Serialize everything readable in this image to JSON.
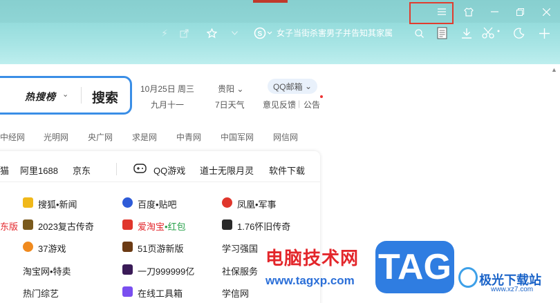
{
  "browser": {
    "news_headline": "女子当街杀害男子并告知其家属",
    "window_controls": [
      "menu-icon",
      "skin-icon",
      "minimize-icon",
      "restore-icon",
      "close-icon"
    ],
    "toolbar_icons": [
      "lightning-icon",
      "share-icon",
      "star-icon",
      "chevron-down-icon",
      "sogou-search-icon",
      "search-icon",
      "notes-icon",
      "download-icon",
      "scissors-icon",
      "moon-icon",
      "plus-icon"
    ]
  },
  "search": {
    "hot_label": "热搜榜",
    "button": "搜索"
  },
  "info": {
    "date": "10月25日 周三",
    "lunar": "九月十一",
    "city": "贵阳",
    "weather_link": "7日天气",
    "mail": "QQ邮箱",
    "feedback": "意见反馈",
    "notice": "公告"
  },
  "nav_links": [
    "中经网",
    "光明网",
    "央广网",
    "求是网",
    "中青网",
    "中国军网",
    "网信网"
  ],
  "quick_links": [
    "猫",
    "阿里1688",
    "京东",
    "QQ游戏",
    "道士无限月灵",
    "软件下载"
  ],
  "sites": [
    {
      "text": "搜狐•新闻"
    },
    {
      "text": "百度•贴吧"
    },
    {
      "text": "凤凰•军事"
    },
    {
      "text": "2023复古传奇"
    },
    {
      "text_a": "爱淘宝",
      "text_b": "•红包"
    },
    {
      "text": "1.76怀旧传奇"
    },
    {
      "text": "37游戏"
    },
    {
      "text": "51页游新版"
    },
    {
      "text": "学习强国"
    },
    {
      "text": "淘宝网•特卖"
    },
    {
      "text": "一刀999999亿"
    },
    {
      "text": "社保服务"
    },
    {
      "text": "热门综艺"
    },
    {
      "text": "在线工具箱"
    },
    {
      "text": "学信网"
    }
  ],
  "left_cut": {
    "row1": "东版"
  },
  "watermark": {
    "line1": "电脑技术网",
    "line2": "www.tagxp.com",
    "badge": "TAG",
    "brand": "极光下载站",
    "brand_url": "www.xz7.com"
  },
  "colors": {
    "accent": "#3a8ee6",
    "highlight_box": "#e03c2e",
    "top_bg": "#95dcdc"
  }
}
